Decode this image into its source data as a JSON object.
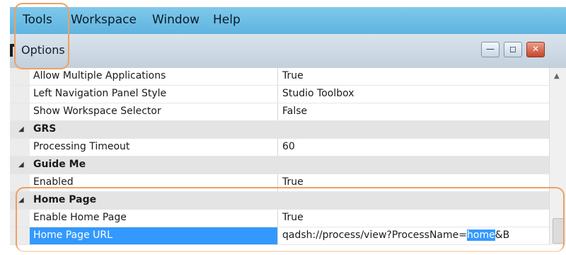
{
  "menubar": {
    "items": [
      "Tools",
      "Workspace",
      "Window",
      "Help"
    ]
  },
  "options_window": {
    "title": "Options",
    "controls": {
      "minimize": "—",
      "restore": "◻",
      "close": "✕"
    }
  },
  "properties": [
    {
      "type": "property",
      "name": "Allow Multiple Applications",
      "value": "True"
    },
    {
      "type": "property",
      "name": "Left Navigation Panel Style",
      "value": "Studio Toolbox"
    },
    {
      "type": "property",
      "name": "Show Workspace Selector",
      "value": "False"
    },
    {
      "type": "category",
      "name": "GRS",
      "expander": "◢"
    },
    {
      "type": "property",
      "name": "Processing Timeout",
      "value": "60"
    },
    {
      "type": "category",
      "name": "Guide Me",
      "expander": "◢"
    },
    {
      "type": "property",
      "name": "Enabled",
      "value": "True"
    },
    {
      "type": "category",
      "name": "Home Page",
      "expander": "◢"
    },
    {
      "type": "property",
      "name": "Enable Home Page",
      "value": "True"
    },
    {
      "type": "property",
      "name": "Home Page URL",
      "value_prefix": "qadsh://process/view?ProcessName=",
      "value_selected": "home",
      "value_suffix": "&B",
      "selected": true
    }
  ],
  "scrollbar": {
    "up_arrow": "▲"
  },
  "colors": {
    "selection": "#3399ff",
    "callout": "#f0a060",
    "menubar": "#6bbde5"
  }
}
